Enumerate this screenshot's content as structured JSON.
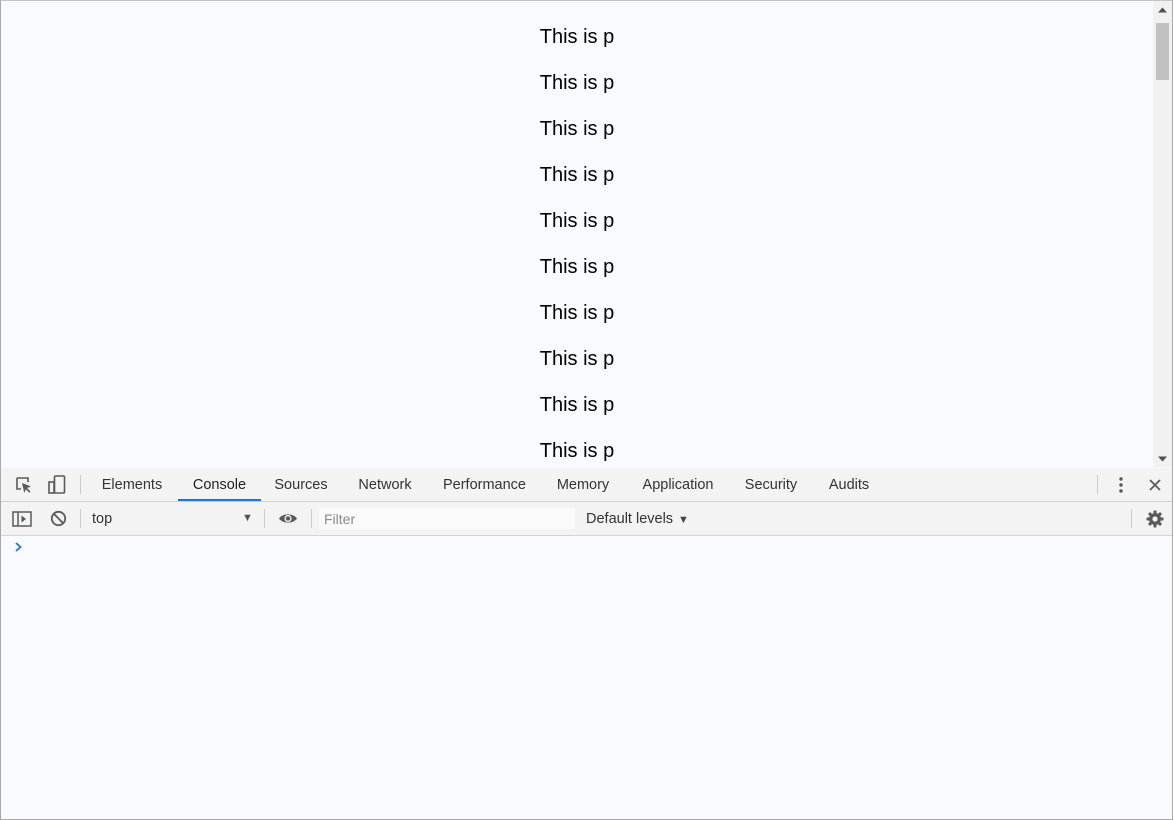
{
  "page": {
    "paragraphs": [
      "This is p",
      "This is p",
      "This is p",
      "This is p",
      "This is p",
      "This is p",
      "This is p",
      "This is p",
      "This is p",
      "This is p"
    ]
  },
  "devtools": {
    "tabs": [
      {
        "label": "Elements"
      },
      {
        "label": "Console",
        "active": true
      },
      {
        "label": "Sources"
      },
      {
        "label": "Network"
      },
      {
        "label": "Performance"
      },
      {
        "label": "Memory"
      },
      {
        "label": "Application"
      },
      {
        "label": "Security"
      },
      {
        "label": "Audits"
      }
    ],
    "toolbar": {
      "context": "top",
      "filter_placeholder": "Filter",
      "levels_label": "Default levels"
    },
    "icons": {
      "inspect": "inspect-element-icon",
      "device": "device-toolbar-icon",
      "more": "more-vertical-icon",
      "close": "close-icon",
      "sidebar": "sidebar-toggle-icon",
      "clear": "clear-console-icon",
      "eye": "live-expression-eye-icon",
      "settings": "gear-icon",
      "prompt": "chevron-right-icon"
    },
    "colors": {
      "accent": "#1a73e8",
      "toolbar_bg": "#f3f3f3",
      "page_bg": "#f8faff"
    }
  }
}
